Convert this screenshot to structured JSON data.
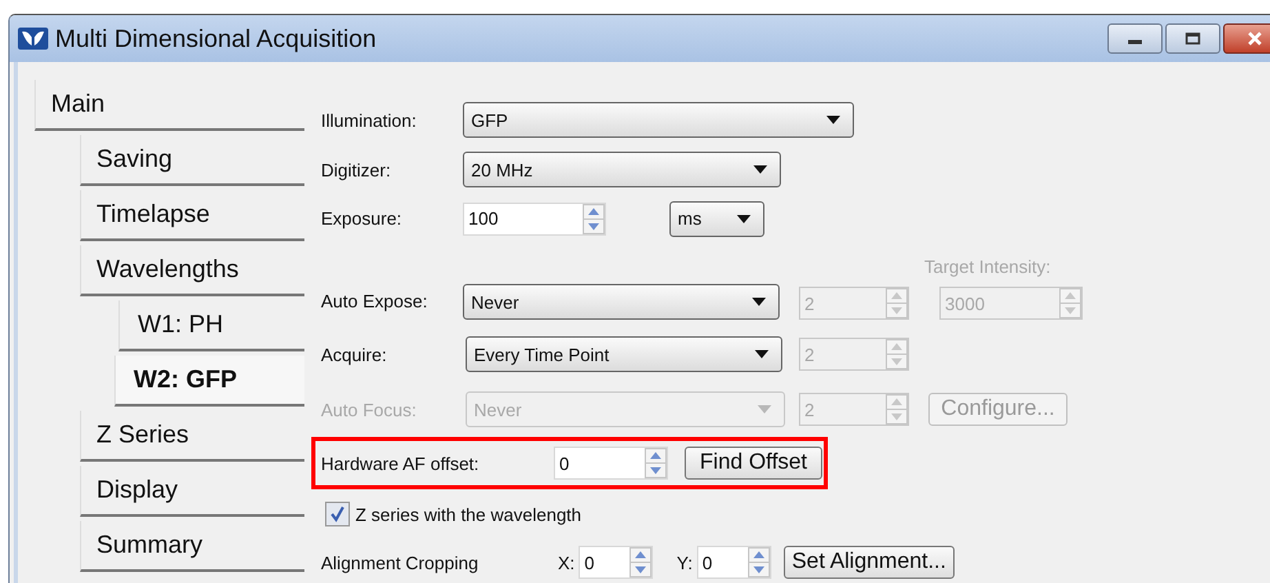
{
  "window": {
    "title": "Multi Dimensional Acquisition"
  },
  "sidebar": {
    "items": [
      {
        "label": "Main",
        "selected": false,
        "children": [
          {
            "label": "Saving",
            "selected": false
          },
          {
            "label": "Timelapse",
            "selected": false
          },
          {
            "label": "Wavelengths",
            "selected": false,
            "children": [
              {
                "label": "W1: PH",
                "selected": false
              },
              {
                "label": "W2: GFP",
                "selected": true
              }
            ]
          },
          {
            "label": "Z Series",
            "selected": false
          },
          {
            "label": "Display",
            "selected": false
          },
          {
            "label": "Summary",
            "selected": false
          }
        ]
      }
    ]
  },
  "form": {
    "rows": [
      {
        "label": "Illumination:",
        "disabled": false,
        "highlighted": false,
        "controls": [
          {
            "kind": "select",
            "value": "GFP",
            "disabled": false
          }
        ]
      },
      {
        "label": "Digitizer:",
        "disabled": false,
        "highlighted": false,
        "controls": [
          {
            "kind": "select",
            "value": "20 MHz",
            "disabled": false
          }
        ]
      },
      {
        "label": "Exposure:",
        "disabled": false,
        "highlighted": false,
        "controls": [
          {
            "kind": "spin",
            "value": "100",
            "disabled": false
          },
          {
            "kind": "select",
            "value": "ms",
            "disabled": false
          }
        ]
      },
      {
        "label": "Auto Expose:",
        "disabled": false,
        "highlighted": false,
        "controls": [
          {
            "kind": "select",
            "value": "Never",
            "disabled": false
          },
          {
            "kind": "spin",
            "value": "2",
            "disabled": true
          },
          {
            "kind": "spin",
            "value": "3000",
            "disabled": true,
            "caption": "Target Intensity:"
          }
        ]
      },
      {
        "label": "Acquire:",
        "disabled": false,
        "highlighted": false,
        "controls": [
          {
            "kind": "select",
            "value": "Every Time Point",
            "disabled": false
          },
          {
            "kind": "spin",
            "value": "2",
            "disabled": true
          }
        ]
      },
      {
        "label": "Auto Focus:",
        "disabled": true,
        "highlighted": false,
        "controls": [
          {
            "kind": "select",
            "value": "Never",
            "disabled": true
          },
          {
            "kind": "spin",
            "value": "2",
            "disabled": true
          },
          {
            "kind": "button",
            "value": "Configure...",
            "disabled": true
          }
        ]
      },
      {
        "label": "Hardware AF offset:",
        "disabled": false,
        "highlighted": true,
        "controls": [
          {
            "kind": "spin",
            "value": "0",
            "disabled": false
          },
          {
            "kind": "button",
            "value": "Find Offset",
            "disabled": false
          }
        ]
      },
      {
        "label": "Z series with the wavelength",
        "kind": "checkbox",
        "checked": true,
        "disabled": false,
        "highlighted": false,
        "controls": []
      },
      {
        "label": "Alignment Cropping",
        "disabled": false,
        "highlighted": false,
        "controls": [
          {
            "kind": "text",
            "value": "X:"
          },
          {
            "kind": "spin",
            "value": "0",
            "disabled": false
          },
          {
            "kind": "text",
            "value": "Y:"
          },
          {
            "kind": "spin",
            "value": "0",
            "disabled": false
          },
          {
            "kind": "button",
            "value": "Set Alignment...",
            "disabled": false
          }
        ]
      }
    ]
  }
}
